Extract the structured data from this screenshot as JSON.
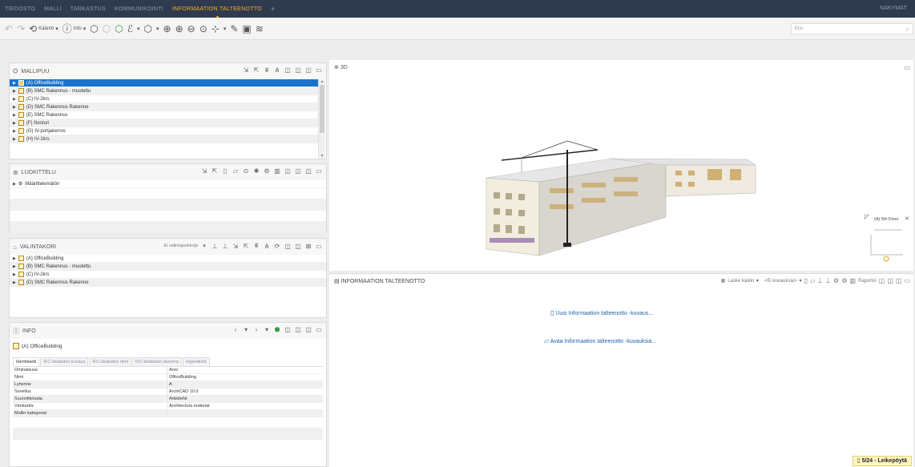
{
  "menu": {
    "items": [
      "TIEDOSTO",
      "MALLI",
      "TARKASTUS",
      "KOMMUNIKOINTI",
      "INFORMAATION TALTEENOTTO"
    ],
    "active_index": 4,
    "add_label": "+",
    "right_label": "NÄKYMÄT"
  },
  "toolbar": {
    "rotate_label": "Kääntö",
    "info_label": "Info",
    "search_placeholder": "Etsi"
  },
  "model_tree": {
    "title": "MALLIPUU",
    "items": [
      {
        "label": "(A) OfficeBuilding",
        "selected": true
      },
      {
        "label": "(B) SMC Rakennus - muutettu"
      },
      {
        "label": "(C) IV-2krs"
      },
      {
        "label": "(D) SMC Rakennus Rakenne"
      },
      {
        "label": "(E) SMC Rakennus"
      },
      {
        "label": "(F) Nosturi"
      },
      {
        "label": "(G) IV-pohjakerros"
      },
      {
        "label": "(H) IV-1krs"
      }
    ]
  },
  "classification": {
    "title": "LUOKITTELU",
    "items": [
      {
        "label": "Määrittelemätön"
      }
    ]
  },
  "selection_basket": {
    "title": "VALINTAKORI",
    "dropdown_label": "Ei valintajoukkoja",
    "items": [
      {
        "label": "(A) OfficeBuilding"
      },
      {
        "label": "(B) SMC Rakennus - muutettu"
      },
      {
        "label": "(C) IV-2krs"
      },
      {
        "label": "(D) SMC Rakennus Rakenne"
      }
    ]
  },
  "info": {
    "title": "INFO",
    "object_name": "(A) OfficeBuilding",
    "tabs": [
      "Identiteetti",
      "IFC-tiedoston kuvaus",
      "IFC-tiedoston nimi",
      "IFC-tiedoston skeema",
      "Hyperlinkit"
    ],
    "active_tab": 0,
    "header": {
      "key": "Ominaisuus",
      "value": "Arvo"
    },
    "rows": [
      {
        "key": "Nimi",
        "value": "OfficeBuilding"
      },
      {
        "key": "Lyhenne",
        "value": "A"
      },
      {
        "key": "Sovellus",
        "value": "ArchiCAD 10.0"
      },
      {
        "key": "Suunnitteluala",
        "value": "Arkkitehti"
      },
      {
        "key": "Värikartta",
        "value": "Architecture.material"
      },
      {
        "key": "Mallin kategoriat",
        "value": ""
      }
    ]
  },
  "viewport": {
    "title": "3D",
    "floor_label": "(A) 5th Floor"
  },
  "info_extraction": {
    "title": "INFORMAATION TALTEENOTTO",
    "count_all_label": "Laske kaikki",
    "description_dropdown": "<Ei kuvauksia>",
    "report_label": "Raportoi",
    "new_link": "Uusi Informaation talteenotto -kuvaus...",
    "open_link": "Avaa Informaation talteenotto -kuvauksia..."
  },
  "clipboard": {
    "label": "5/24 - Leikepöytä"
  }
}
